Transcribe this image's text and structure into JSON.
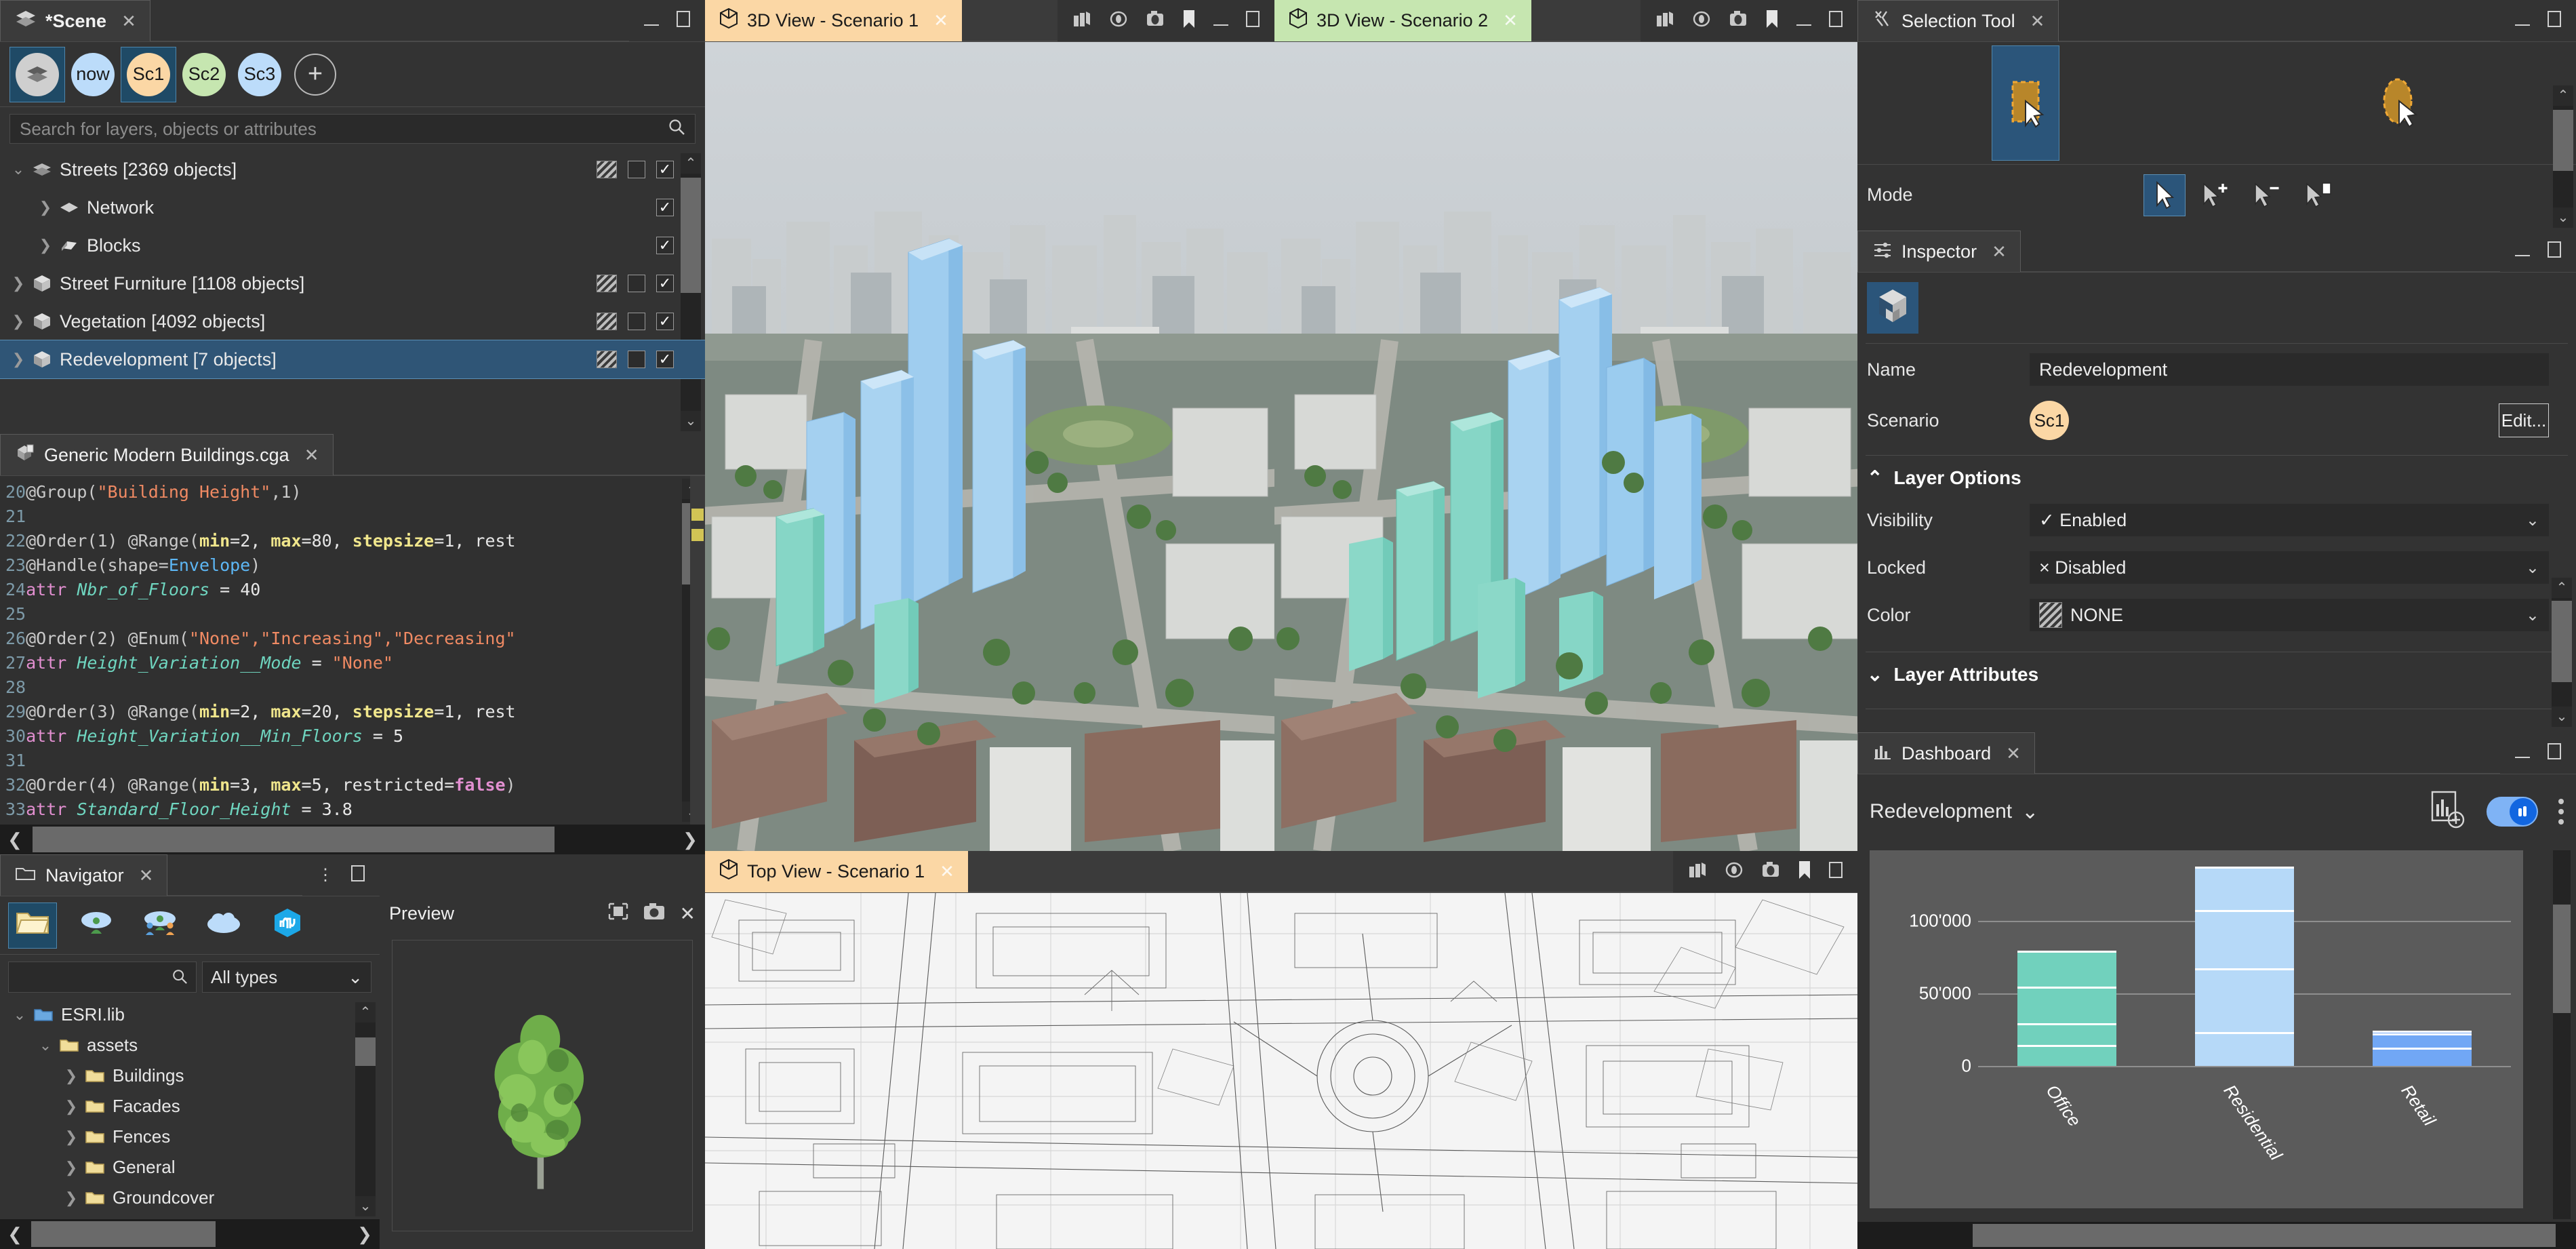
{
  "scene": {
    "tab_title": "*Scene",
    "tab_icon": "layers-icon",
    "scenarios": [
      {
        "label": "",
        "icon": "layers-icon",
        "color": "#cfcfcf",
        "selected": true
      },
      {
        "label": "now",
        "color": "#bcdcfa",
        "selected": false
      },
      {
        "label": "Sc1",
        "color": "#fbd7a5",
        "selected": true
      },
      {
        "label": "Sc2",
        "color": "#c6e6b0",
        "selected": false
      },
      {
        "label": "Sc3",
        "color": "#bcdcfa",
        "selected": false
      }
    ],
    "add_scenario_label": "+",
    "search_placeholder": "Search for layers, objects or attributes",
    "search_value": "",
    "layers": [
      {
        "label": "Streets [2369 objects]",
        "indent": 0,
        "expanded": true,
        "icon": "streets-layer-icon",
        "hatch": true,
        "box": true,
        "checked": true,
        "selected": false
      },
      {
        "label": "Network",
        "indent": 1,
        "expanded": false,
        "icon": "network-layer-icon",
        "hatch": false,
        "box": false,
        "checked": true,
        "selected": false
      },
      {
        "label": "Blocks",
        "indent": 1,
        "expanded": false,
        "icon": "blocks-layer-icon",
        "hatch": false,
        "box": false,
        "checked": true,
        "selected": false
      },
      {
        "label": "Street Furniture [1108 objects]",
        "indent": 0,
        "expanded": false,
        "icon": "model-layer-icon",
        "hatch": true,
        "box": true,
        "checked": true,
        "selected": false
      },
      {
        "label": "Vegetation [4092 objects]",
        "indent": 0,
        "expanded": false,
        "icon": "model-layer-icon",
        "hatch": true,
        "box": true,
        "checked": true,
        "selected": false
      },
      {
        "label": "Redevelopment [7 objects]",
        "indent": 0,
        "expanded": false,
        "icon": "model-layer-icon",
        "hatch": true,
        "box": true,
        "checked": true,
        "selected": true
      }
    ]
  },
  "cga": {
    "tab_title": "Generic Modern Buildings.cga",
    "tab_icon": "cga-file-icon",
    "lines": [
      {
        "no": "20",
        "tokens": [
          {
            "t": "@Group(",
            "c": "an"
          },
          {
            "t": "\"Building Height\"",
            "c": "str"
          },
          {
            "t": ",1)",
            "c": "an"
          }
        ]
      },
      {
        "no": "21",
        "tokens": []
      },
      {
        "no": "22",
        "tokens": [
          {
            "t": "@Order(1) @Range(",
            "c": "an"
          },
          {
            "t": "min",
            "c": "par"
          },
          {
            "t": "=2, ",
            "c": "num"
          },
          {
            "t": "max",
            "c": "par"
          },
          {
            "t": "=80, ",
            "c": "num"
          },
          {
            "t": "stepsize",
            "c": "par"
          },
          {
            "t": "=1, rest",
            "c": "num"
          }
        ]
      },
      {
        "no": "23",
        "tokens": [
          {
            "t": "@Handle(shape=",
            "c": "an"
          },
          {
            "t": "Envelope",
            "c": "ty"
          },
          {
            "t": ")",
            "c": "an"
          }
        ]
      },
      {
        "no": "24",
        "tokens": [
          {
            "t": "attr ",
            "c": "kw"
          },
          {
            "t": "Nbr_of_Floors",
            "c": "id"
          },
          {
            "t": " = ",
            "c": "num"
          },
          {
            "t": "40",
            "c": "num"
          }
        ]
      },
      {
        "no": "25",
        "tokens": []
      },
      {
        "no": "26",
        "tokens": [
          {
            "t": "@Order(2) @Enum(",
            "c": "an"
          },
          {
            "t": "\"None\",\"Increasing\",\"Decreasing\"",
            "c": "str"
          }
        ]
      },
      {
        "no": "27",
        "tokens": [
          {
            "t": "attr ",
            "c": "kw"
          },
          {
            "t": "Height_Variation__Mode",
            "c": "id"
          },
          {
            "t": " = ",
            "c": "num"
          },
          {
            "t": "\"None\"",
            "c": "str"
          }
        ]
      },
      {
        "no": "28",
        "tokens": []
      },
      {
        "no": "29",
        "tokens": [
          {
            "t": "@Order(3) @Range(",
            "c": "an"
          },
          {
            "t": "min",
            "c": "par"
          },
          {
            "t": "=2, ",
            "c": "num"
          },
          {
            "t": "max",
            "c": "par"
          },
          {
            "t": "=20, ",
            "c": "num"
          },
          {
            "t": "stepsize",
            "c": "par"
          },
          {
            "t": "=1, rest",
            "c": "num"
          }
        ]
      },
      {
        "no": "30",
        "tokens": [
          {
            "t": "attr ",
            "c": "kw"
          },
          {
            "t": "Height_Variation__Min_Floors",
            "c": "id"
          },
          {
            "t": " = ",
            "c": "num"
          },
          {
            "t": "5",
            "c": "num"
          }
        ]
      },
      {
        "no": "31",
        "tokens": []
      },
      {
        "no": "32",
        "tokens": [
          {
            "t": "@Order(4) @Range(",
            "c": "an"
          },
          {
            "t": "min",
            "c": "par"
          },
          {
            "t": "=3, ",
            "c": "num"
          },
          {
            "t": "max",
            "c": "par"
          },
          {
            "t": "=5, restricted=",
            "c": "num"
          },
          {
            "t": "false",
            "c": "bool"
          },
          {
            "t": ")",
            "c": "an"
          }
        ]
      },
      {
        "no": "33",
        "tokens": [
          {
            "t": "attr ",
            "c": "kw"
          },
          {
            "t": "Standard_Floor_Height",
            "c": "id"
          },
          {
            "t": " = ",
            "c": "num"
          },
          {
            "t": "3.8",
            "c": "num"
          }
        ]
      }
    ]
  },
  "navigator": {
    "tab_title": "Navigator",
    "tab_icon": "folder-icon",
    "source_icons": [
      "local-folder-icon",
      "my-content-cloud-icon",
      "shared-content-cloud-icon",
      "public-cloud-icon",
      "esri-datastore-icon"
    ],
    "search_placeholder": "",
    "search_value": "",
    "type_filter": "All types",
    "tree": [
      {
        "label": "ESRI.lib",
        "indent": 0,
        "expanded": true,
        "icon": "lib-folder-icon"
      },
      {
        "label": "assets",
        "indent": 1,
        "expanded": true,
        "icon": "folder-icon"
      },
      {
        "label": "Buildings",
        "indent": 2,
        "expanded": false,
        "icon": "folder-icon"
      },
      {
        "label": "Facades",
        "indent": 2,
        "expanded": false,
        "icon": "folder-icon"
      },
      {
        "label": "Fences",
        "indent": 2,
        "expanded": false,
        "icon": "folder-icon"
      },
      {
        "label": "General",
        "indent": 2,
        "expanded": false,
        "icon": "folder-icon"
      },
      {
        "label": "Groundcover",
        "indent": 2,
        "expanded": false,
        "icon": "folder-icon"
      }
    ]
  },
  "preview": {
    "title": "Preview",
    "buttons": [
      "fit-view-icon",
      "camera-icon",
      "close-icon"
    ],
    "content": "tree-asset-preview"
  },
  "viewports": [
    {
      "title": "3D View - Scenario 1",
      "accent": "#fbd7a5",
      "icon": "cube-icon",
      "tools": [
        "layers-icon",
        "eye-icon",
        "camera-icon",
        "bookmark-icon"
      ]
    },
    {
      "title": "3D View - Scenario 2",
      "accent": "#c6e6b0",
      "icon": "cube-icon",
      "tools": [
        "layers-icon",
        "eye-icon",
        "camera-icon",
        "bookmark-icon"
      ]
    },
    {
      "title": "Top View - Scenario 1",
      "accent": "#fbd7a5",
      "icon": "cube-icon",
      "tools": [
        "layers-icon",
        "eye-icon",
        "camera-icon",
        "bookmark-icon"
      ]
    }
  ],
  "selection_tool": {
    "tab_title": "Selection Tool",
    "tab_icon": "selection-tool-icon",
    "shapes": [
      {
        "name": "rectangle-select-icon",
        "selected": true
      },
      {
        "name": "lasso-select-icon",
        "selected": false
      }
    ],
    "mode_label": "Mode",
    "modes": [
      {
        "name": "select-replace-icon",
        "selected": true
      },
      {
        "name": "select-add-icon",
        "selected": false
      },
      {
        "name": "select-subtract-icon",
        "selected": false
      },
      {
        "name": "select-intersect-icon",
        "selected": false
      }
    ]
  },
  "inspector": {
    "tab_title": "Inspector",
    "tab_icon": "inspector-icon",
    "object_icon": "layer-object-icon",
    "name_label": "Name",
    "name_value": "Redevelopment",
    "scenario_label": "Scenario",
    "scenario_value": "Sc1",
    "scenario_color": "#fbd7a5",
    "edit_label": "Edit...",
    "layer_options_label": "Layer Options",
    "layer_options_expanded": true,
    "options": [
      {
        "label": "Visibility",
        "value": "✓ Enabled"
      },
      {
        "label": "Locked",
        "value": "× Disabled"
      },
      {
        "label": "Color",
        "value": "NONE",
        "swatch": "hatch"
      }
    ],
    "layer_attributes_label": "Layer Attributes",
    "layer_attributes_expanded": false
  },
  "dashboard": {
    "tab_title": "Dashboard",
    "tab_icon": "dashboard-icon",
    "layer_select": "Redevelopment",
    "actions": [
      "add-chart-icon",
      "live-data-toggle",
      "more-options-icon"
    ],
    "toggle_on": true
  },
  "chart_data": {
    "type": "bar",
    "stacked": true,
    "title": "",
    "xlabel": "",
    "ylabel": "",
    "categories": [
      "Office",
      "Residential",
      "Retail"
    ],
    "ytick_labels": [
      "100'000",
      "50'000",
      "0"
    ],
    "ytick_values": [
      100000,
      50000,
      0
    ],
    "ylim": [
      0,
      140000
    ],
    "grid": true,
    "legend": "none",
    "series": [
      {
        "name": "Office",
        "color": "#71d1bd",
        "total": 78000,
        "segments": [
          13000,
          15000,
          25000,
          25000
        ]
      },
      {
        "name": "Residential",
        "color": "#b6d9f8",
        "total": 136000,
        "segments": [
          22000,
          44000,
          40000,
          30000
        ]
      },
      {
        "name": "Retail",
        "color": "#71a7f5",
        "total": 23000,
        "segments": [
          11000,
          10000,
          2000
        ]
      }
    ]
  }
}
